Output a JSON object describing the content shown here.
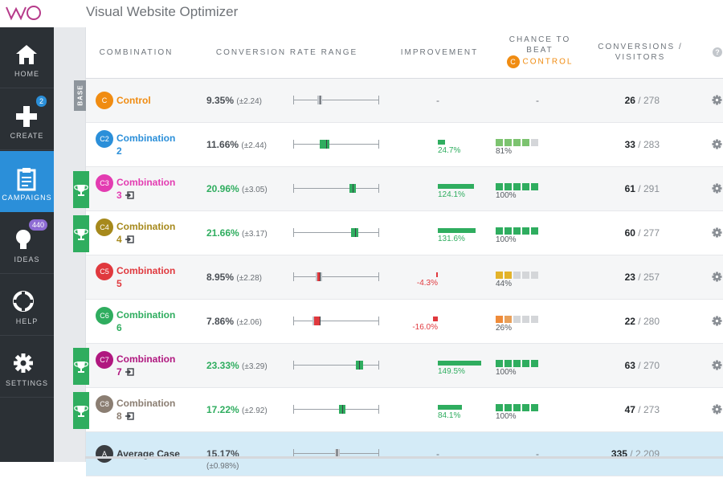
{
  "app": {
    "title": "Visual Website Optimizer",
    "logo_text": "VWO"
  },
  "sidebar": {
    "items": [
      {
        "label": "HOME",
        "icon": "home-icon",
        "active": false
      },
      {
        "label": "CREATE",
        "icon": "plus-icon",
        "active": false,
        "badge": "2",
        "badge_color": "#2b8fd9"
      },
      {
        "label": "CAMPAIGNS",
        "icon": "clipboard-icon",
        "active": true
      },
      {
        "label": "IDEAS",
        "icon": "lightbulb-icon",
        "active": false,
        "badge": "440",
        "badge_color": "#8d6bd3"
      },
      {
        "label": "HELP",
        "icon": "lifebuoy-icon",
        "active": false
      },
      {
        "label": "SETTINGS",
        "icon": "gear-icon",
        "active": false
      }
    ]
  },
  "table": {
    "headers": {
      "combination": "COMBINATION",
      "range": "CONVERSION RATE RANGE",
      "improvement": "IMPROVEMENT",
      "chance_line1": "CHANCE TO",
      "chance_line2": "BEAT",
      "chance_badge": "C",
      "chance_line3": "CONTROL",
      "conversions_line1": "CONVERSIONS /",
      "conversions_line2": "VISITORS"
    },
    "base_label": "BASE",
    "rows": [
      {
        "badge": "C",
        "color": "#f08c12",
        "name": "Control",
        "idx": "",
        "rate": "9.35%",
        "pm": "(±2.24)",
        "winner": false,
        "improvement": "-",
        "chance": "-",
        "chance_level": null,
        "squares": [],
        "conv": "26",
        "visitors": "278",
        "improvement_pct": null,
        "range_low": 7.11,
        "range_high": 11.59
      },
      {
        "badge": "C2",
        "color": "#2b8fd9",
        "name": "Combination",
        "idx": "2",
        "rate": "11.66%",
        "pm": "(±2.44)",
        "winner": false,
        "improvement": "24.7%",
        "improvement_pct": 24.7,
        "chance": "81%",
        "squares": [
          "#7cc36f",
          "#7cc36f",
          "#7cc36f",
          "#7cc36f",
          "#d4d6d9"
        ],
        "conv": "33",
        "visitors": "283",
        "range_low": 9.22,
        "range_high": 14.1
      },
      {
        "badge": "C3",
        "color": "#e33cb1",
        "name": "Combination",
        "idx": "3",
        "rate": "20.96%",
        "pm": "(±3.05)",
        "winner": true,
        "improvement": "124.1%",
        "improvement_pct": 124.1,
        "chance": "100%",
        "squares": [
          "#2fad5f",
          "#2fad5f",
          "#2fad5f",
          "#2fad5f",
          "#2fad5f"
        ],
        "conv": "61",
        "visitors": "291",
        "range_low": 17.91,
        "range_high": 24.01
      },
      {
        "badge": "C4",
        "color": "#a6891c",
        "name": "Combination",
        "idx": "4",
        "rate": "21.66%",
        "pm": "(±3.17)",
        "winner": true,
        "improvement": "131.6%",
        "improvement_pct": 131.6,
        "chance": "100%",
        "squares": [
          "#2fad5f",
          "#2fad5f",
          "#2fad5f",
          "#2fad5f",
          "#2fad5f"
        ],
        "conv": "60",
        "visitors": "277",
        "range_low": 18.49,
        "range_high": 24.83
      },
      {
        "badge": "C5",
        "color": "#e0393e",
        "name": "Combination",
        "idx": "5",
        "rate": "8.95%",
        "pm": "(±2.28)",
        "winner": false,
        "improvement": "-4.3%",
        "improvement_pct": -4.3,
        "chance": "44%",
        "squares": [
          "#e3b32a",
          "#e3b32a",
          "#d4d6d9",
          "#d4d6d9",
          "#d4d6d9"
        ],
        "conv": "23",
        "visitors": "257",
        "range_low": 6.67,
        "range_high": 11.23
      },
      {
        "badge": "C6",
        "color": "#2fad5f",
        "name": "Combination",
        "idx": "6",
        "rate": "7.86%",
        "pm": "(±2.06)",
        "winner": false,
        "improvement": "-16.0%",
        "improvement_pct": -16.0,
        "chance": "26%",
        "squares": [
          "#ef8b3a",
          "#e8a05a",
          "#d4d6d9",
          "#d4d6d9",
          "#d4d6d9"
        ],
        "conv": "22",
        "visitors": "280",
        "range_low": 5.8,
        "range_high": 9.92
      },
      {
        "badge": "C7",
        "color": "#b0177f",
        "name": "Combination",
        "idx": "7",
        "rate": "23.33%",
        "pm": "(±3.29)",
        "winner": true,
        "improvement": "149.5%",
        "improvement_pct": 149.5,
        "chance": "100%",
        "squares": [
          "#2fad5f",
          "#2fad5f",
          "#2fad5f",
          "#2fad5f",
          "#2fad5f"
        ],
        "conv": "63",
        "visitors": "270",
        "range_low": 20.04,
        "range_high": 26.62
      },
      {
        "badge": "C8",
        "color": "#8b7e72",
        "name": "Combination",
        "idx": "8",
        "rate": "17.22%",
        "pm": "(±2.92)",
        "winner": true,
        "improvement": "84.1%",
        "improvement_pct": 84.1,
        "chance": "100%",
        "squares": [
          "#2fad5f",
          "#2fad5f",
          "#2fad5f",
          "#2fad5f",
          "#2fad5f"
        ],
        "conv": "47",
        "visitors": "273",
        "range_low": 14.3,
        "range_high": 20.14
      },
      {
        "badge": "A",
        "color": "#3a3d41",
        "name": "Average Case",
        "idx": "",
        "rate": "15.17%",
        "pm": "(±0.98%)",
        "winner": false,
        "improvement": "-",
        "chance": "-",
        "squares": [],
        "conv": "335",
        "visitors": "2,209",
        "improvement_pct": null,
        "range_low": 14.19,
        "range_high": 16.15
      }
    ]
  },
  "colors": {
    "sidebar": "#2b3035",
    "accent": "#2b8fd9",
    "winner": "#2fad5f",
    "negative": "#e0393e",
    "control": "#f08c12"
  }
}
